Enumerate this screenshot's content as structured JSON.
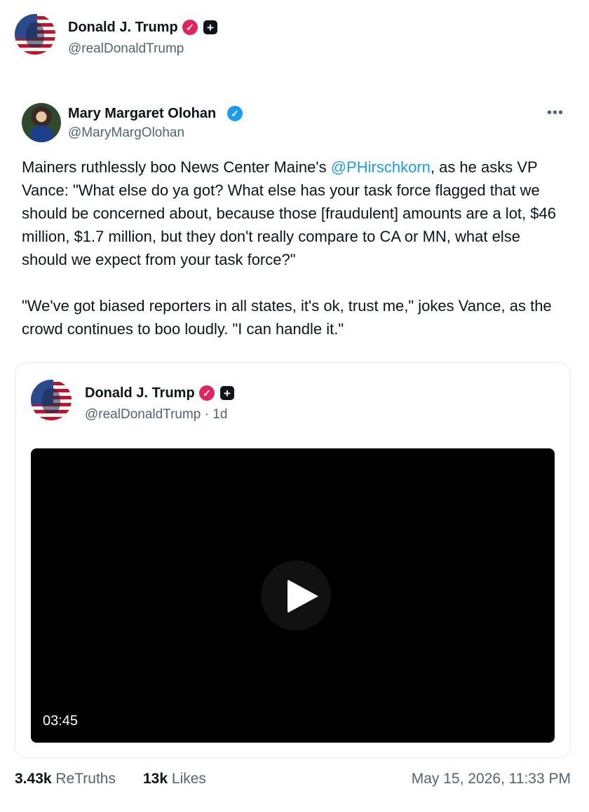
{
  "post": {
    "author_name": "Donald J. Trump",
    "author_handle": "@realDonaldTrump"
  },
  "quoted_tweet": {
    "author_name": "Mary Margaret Olohan",
    "author_handle": "@MaryMargOlohan",
    "more_label": "•••",
    "text_p1_before": "Mainers ruthlessly boo News Center Maine's ",
    "mention": "@PHirschkorn",
    "text_p1_after": ", as he asks VP Vance: \"What else do ya got? What else has your task force flagged that we should be concerned about, because those [fraudulent] amounts are a lot, $46 million, $1.7 million, but they don't really compare to CA or MN, what else should we expect from your task force?\"",
    "text_p2": "\"We've got biased reporters in all states, it's ok, trust me,\" jokes Vance, as the crowd continues to boo loudly. \"I can handle it.\""
  },
  "embedded_card": {
    "author_name": "Donald J. Trump",
    "author_handle_time": "@realDonaldTrump · 1d",
    "video_duration": "03:45"
  },
  "stats": {
    "retruths_count": "3.43k",
    "retruths_label": "ReTruths",
    "likes_count": "13k",
    "likes_label": "Likes",
    "timestamp": "May 15, 2026, 11:33 PM"
  },
  "icons": {
    "verified_pink": "verified-badge-icon",
    "verified_blue": "verified-badge-icon",
    "plus_square": "plus-square-icon",
    "play": "play-icon"
  },
  "colors": {
    "link": "#1d9bf0",
    "verified_pink": "#e0245e",
    "muted_text": "#536471"
  }
}
